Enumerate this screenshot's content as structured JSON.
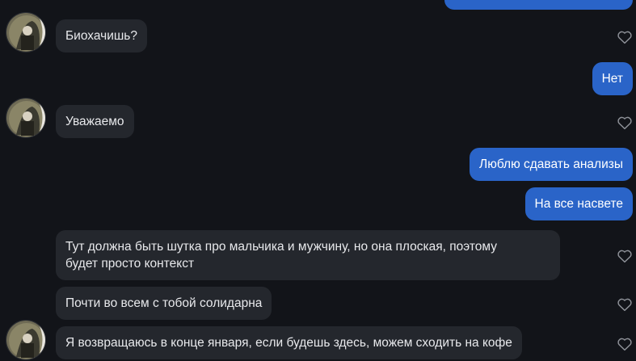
{
  "messages": [
    {
      "id": "m1",
      "direction": "incoming",
      "text": "Биохачишь?",
      "has_avatar": true
    },
    {
      "id": "m2",
      "direction": "outgoing",
      "text": "Нет"
    },
    {
      "id": "m3",
      "direction": "incoming",
      "text": "Уважаемо",
      "has_avatar": true
    },
    {
      "id": "m4",
      "direction": "outgoing",
      "text": "Люблю сдавать анализы"
    },
    {
      "id": "m5",
      "direction": "outgoing",
      "text": "На все насвете"
    },
    {
      "id": "m6",
      "direction": "incoming",
      "text_lines": [
        "Тут должна быть шутка про мальчика и мужчину, но она плоская, поэтому",
        "будет просто контекст"
      ],
      "has_avatar": false
    },
    {
      "id": "m7",
      "direction": "incoming",
      "text": "Почти во всем с тобой солидарна",
      "has_avatar": false
    },
    {
      "id": "m8",
      "direction": "incoming",
      "text": "Я возвращаюсь в конце января, если будешь здесь, можем сходить на кофе",
      "has_avatar": true
    }
  ],
  "icons": {
    "like": "heart-outline-icon",
    "avatar": "contact-avatar-photo"
  },
  "colors": {
    "background": "#121419",
    "incoming_bubble": "#24272d",
    "outgoing_bubble": "#2a64c8",
    "text": "#e8e9ec",
    "heart": "#8e9198"
  }
}
